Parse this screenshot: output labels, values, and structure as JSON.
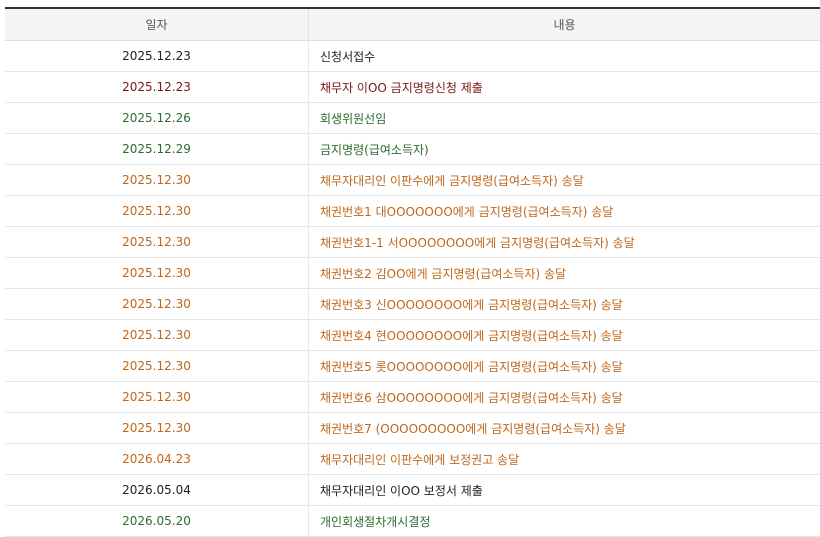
{
  "table": {
    "headers": {
      "date": "일자",
      "content": "내용"
    },
    "rows": [
      {
        "date": "2025.12.23",
        "content": "신청서접수",
        "color": "#222222"
      },
      {
        "date": "2025.12.23",
        "content": "채무자 이OO 금지명령신청 제출",
        "color": "#7a1616"
      },
      {
        "date": "2025.12.26",
        "content": "회생위원선임",
        "color": "#2e6b2e"
      },
      {
        "date": "2025.12.29",
        "content": "금지명령(급여소득자)",
        "color": "#2e6b2e"
      },
      {
        "date": "2025.12.30",
        "content": "채무자대리인 이판수에게 금지명령(급여소득자) 송달",
        "color": "#c0661a"
      },
      {
        "date": "2025.12.30",
        "content": "채권번호1 대OOOOOOO에게 금지명령(급여소득자) 송달",
        "color": "#c0661a"
      },
      {
        "date": "2025.12.30",
        "content": "채권번호1-1 서OOOOOOOO에게 금지명령(급여소득자) 송달",
        "color": "#c0661a"
      },
      {
        "date": "2025.12.30",
        "content": "채권번호2 김OO에게 금지명령(급여소득자) 송달",
        "color": "#c0661a"
      },
      {
        "date": "2025.12.30",
        "content": "채권번호3 신OOOOOOOO에게 금지명령(급여소득자) 송달",
        "color": "#c0661a"
      },
      {
        "date": "2025.12.30",
        "content": "채권번호4 현OOOOOOOO에게 금지명령(급여소득자) 송달",
        "color": "#c0661a"
      },
      {
        "date": "2025.12.30",
        "content": "채권번호5 롯OOOOOOOO에게 금지명령(급여소득자) 송달",
        "color": "#c0661a"
      },
      {
        "date": "2025.12.30",
        "content": "채권번호6 삼OOOOOOOO에게 금지명령(급여소득자) 송달",
        "color": "#c0661a"
      },
      {
        "date": "2025.12.30",
        "content": "채권번호7 (OOOOOOOOO에게 금지명령(급여소득자) 송달",
        "color": "#c0661a"
      },
      {
        "date": "2026.04.23",
        "content": "채무자대리인 이판수에게 보정권고 송달",
        "color": "#c0661a"
      },
      {
        "date": "2026.05.04",
        "content": "채무자대리인 이OO 보정서 제출",
        "color": "#222222"
      },
      {
        "date": "2026.05.20",
        "content": "개인회생절차개시결정",
        "color": "#2e6b2e"
      }
    ]
  }
}
